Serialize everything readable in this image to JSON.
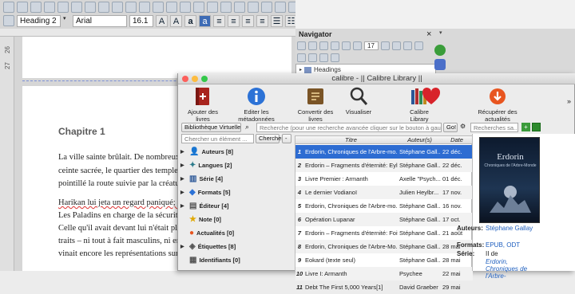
{
  "writer": {
    "paragraph_style": "Heading 2",
    "font_name": "Arial",
    "font_size": "16.1",
    "vruler_numbers": [
      "26",
      "27"
    ],
    "chapter_heading": "Chapitre 1",
    "doc_lines": [
      "La ville sainte brûlait. De nombreux incen",
      "ceinte sacrée, le quartier des temples et des",
      "pointillé la route suivie par la créature qui,",
      "",
      "Harikan lui jeta un regard paniqué; il se t",
      "Les Paladins en charge de la sécurité du li",
      "Celle qu'il avait devant lui n'était plus son",
      "traits – ni tout à fait masculins, ni encore f",
      "vinait encore les représentations sur les mo"
    ]
  },
  "navigator": {
    "title": "Navigator",
    "close": "×",
    "spin_value": "17",
    "headings_label": "Headings"
  },
  "calibre": {
    "window_title": "calibre - || Calibre Library ||",
    "toolbar": [
      {
        "label": "Ajouter des livres",
        "icon": "add-book-icon"
      },
      {
        "label": "Editer les métadonnées",
        "icon": "info-icon"
      },
      {
        "label": "Convertir des livres",
        "icon": "convert-icon"
      },
      {
        "label": "Visualiser",
        "icon": "view-icon"
      },
      {
        "label": "Calibre Library",
        "icon": "library-icon"
      },
      {
        "label": "",
        "icon": "heart-icon"
      },
      {
        "label": "Récupérer des actualités",
        "icon": "news-icon"
      }
    ],
    "more": "»",
    "virtual_library": "Bibliothèque Virtuelle",
    "search_placeholder": "Recherche (pour une recherche avancée cliquer sur le bouton à gau",
    "go_label": "Go!",
    "saved_search_placeholder": "Recherches sa...",
    "tag_search_placeholder": "Chercher un élément ...",
    "find_label": "Chercher",
    "minus_label": "-",
    "tags": [
      {
        "label": "Auteurs [8]",
        "icon": "authors-icon"
      },
      {
        "label": "Langues [2]",
        "icon": "languages-icon"
      },
      {
        "label": "Série [4]",
        "icon": "series-icon"
      },
      {
        "label": "Formats [5]",
        "icon": "formats-icon"
      },
      {
        "label": "Éditeur [4]",
        "icon": "publisher-icon"
      },
      {
        "label": "Note [0]",
        "icon": "rating-icon"
      },
      {
        "label": "Actualités [0]",
        "icon": "news-tag-icon"
      },
      {
        "label": "Étiquettes [8]",
        "icon": "tags-icon"
      },
      {
        "label": "Identifiants [0]",
        "icon": "identifiers-icon"
      }
    ],
    "columns": {
      "title": "Titre",
      "author": "Auteur(s)",
      "date": "Date"
    },
    "books": [
      {
        "n": "1",
        "title": "Erdorin, Chroniques de l'Arbre-mo...",
        "author": "Stéphane Gall...",
        "date": "22 déc."
      },
      {
        "n": "2",
        "title": "Erdorin – Fragments d'éternité: Eyl...",
        "author": "Stéphane Gall...",
        "date": "22 déc."
      },
      {
        "n": "3",
        "title": "Livre Premier : Armanth",
        "author": "Axelle \"Psych...",
        "date": "01 déc."
      },
      {
        "n": "4",
        "title": "Le dernier Vodianoï",
        "author": "Julien Heylbr...",
        "date": "17 nov."
      },
      {
        "n": "5",
        "title": "Erdorin, Chroniques de l'Arbre-mo...",
        "author": "Stéphane Gall...",
        "date": "16 nov."
      },
      {
        "n": "6",
        "title": "Opération Lupanar",
        "author": "Stéphane Gall...",
        "date": "17 oct."
      },
      {
        "n": "7",
        "title": "Erdorin – Fragments d'éternité: Foit...",
        "author": "Stéphane Gall...",
        "date": "21 août"
      },
      {
        "n": "8",
        "title": "Erdorin, Chroniques de l'Arbre-Mo...",
        "author": "Stéphane Gall...",
        "date": "28 mai"
      },
      {
        "n": "9",
        "title": "Eokard (texte seul)",
        "author": "Stéphane Gall...",
        "date": "28 mai"
      },
      {
        "n": "10",
        "title": "Livre I: Armanth",
        "author": "Psychee",
        "date": "22 mai"
      },
      {
        "n": "11",
        "title": "Debt The First 5,000 Years[1]",
        "author": "David Graeber",
        "date": "29 mai"
      }
    ],
    "cover_title": "Erdorin",
    "cover_subtitle": "Chroniques de l'Arbre-Monde",
    "details": {
      "authors_label": "Auteurs:",
      "authors_value": "Stéphane Gallay",
      "formats_label": "Formats:",
      "formats_value": "EPUB, ODT",
      "series_label": "Série:",
      "series_value_prefix": "II de",
      "series_value": "Erdorin, Chroniques de l'Arbre-"
    }
  }
}
